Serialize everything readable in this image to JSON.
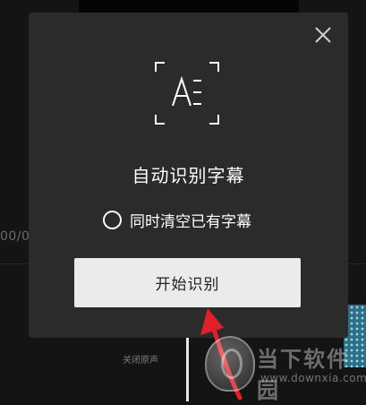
{
  "background": {
    "time_fragment": "00/0",
    "mute_label": "关闭原声"
  },
  "dialog": {
    "icon": "auto-caption-ae-icon",
    "title": "自动识别字幕",
    "option_label": "同时清空已有字幕",
    "option_checked": false,
    "start_button_label": "开始识别",
    "close_icon": "close-icon"
  },
  "watermark": {
    "title": "当下软件园",
    "url": "www.downxia.com"
  },
  "colors": {
    "dialog_bg": "#2b2b2b",
    "button_bg": "#ebebeb",
    "arrow": "#e0202a"
  }
}
